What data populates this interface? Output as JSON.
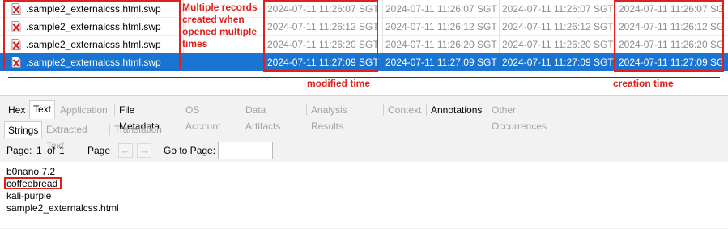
{
  "files": [
    {
      "name": ".sample2_externalcss.html.swp",
      "t1": "2024-07-11 11:26:07 SGT",
      "t2": "2024-07-11 11:26:07 SGT",
      "t3": "2024-07-11 11:26:07 SGT",
      "t4": "2024-07-11 11:26:07 SGT",
      "selected": false
    },
    {
      "name": ".sample2_externalcss.html.swp",
      "t1": "2024-07-11 11:26:12 SGT",
      "t2": "2024-07-11 11:26:12 SGT",
      "t3": "2024-07-11 11:26:12 SGT",
      "t4": "2024-07-11 11:26:12 SGT",
      "selected": false
    },
    {
      "name": ".sample2_externalcss.html.swp",
      "t1": "2024-07-11 11:26:20 SGT",
      "t2": "2024-07-11 11:26:20 SGT",
      "t3": "2024-07-11 11:26:20 SGT",
      "t4": "2024-07-11 11:26:20 SGT",
      "selected": false
    },
    {
      "name": ".sample2_externalcss.html.swp",
      "t1": "2024-07-11 11:27:09 SGT",
      "t2": "2024-07-11 11:27:09 SGT",
      "t3": "2024-07-11 11:27:09 SGT",
      "t4": "2024-07-11 11:27:09 SGT",
      "selected": true
    }
  ],
  "annotations": {
    "multiple_records": "Multiple records created when opened multiple times",
    "modified_time": "modified time",
    "creation_time": "creation time",
    "color": "#e0201c"
  },
  "tabs": [
    {
      "label": "Hex",
      "enabled": true
    },
    {
      "label": "Text",
      "enabled": true,
      "active": true
    },
    {
      "label": "Application",
      "enabled": false
    },
    {
      "label": "File Metadata",
      "enabled": true
    },
    {
      "label": "OS Account",
      "enabled": false
    },
    {
      "label": "Data Artifacts",
      "enabled": false
    },
    {
      "label": "Analysis Results",
      "enabled": false
    },
    {
      "label": "Context",
      "enabled": false
    },
    {
      "label": "Annotations",
      "enabled": true
    },
    {
      "label": "Other Occurrences",
      "enabled": false
    }
  ],
  "subtabs": [
    {
      "label": "Strings",
      "enabled": true,
      "active": true
    },
    {
      "label": "Extracted Text",
      "enabled": false
    },
    {
      "label": "Translation",
      "enabled": false
    }
  ],
  "toolbar": {
    "page_label": "Page:",
    "page_current": "1",
    "of_label": "of",
    "page_total": "1",
    "page_nav_label": "Page",
    "prev_icon": "arrow-left-icon",
    "next_icon": "arrow-right-icon",
    "goto_label": "Go to Page:",
    "goto_value": ""
  },
  "strings": [
    "b0nano 7.2",
    "coffeebread",
    "kali-purple",
    "sample2_externalcss.html"
  ],
  "colors": {
    "selection": "#1a74d2",
    "annotation": "#e0201c",
    "dim_text": "#8c8c8c"
  }
}
